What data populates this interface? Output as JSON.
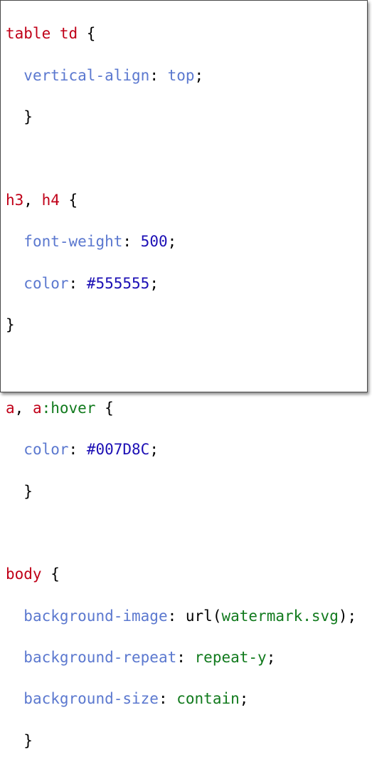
{
  "colors": {
    "selector": "#c00018",
    "property": "#5b78cf",
    "number": "#1c0fb5",
    "string": "#117a1d",
    "punctuation": "#000000"
  },
  "rules": [
    {
      "selector": "table td",
      "declarations": [
        {
          "property": "vertical-align",
          "value": "top"
        }
      ]
    },
    {
      "selector_parts": [
        "h3",
        "h4"
      ],
      "declarations": [
        {
          "property": "font-weight",
          "value": "500"
        },
        {
          "property": "color",
          "value": "#555555"
        }
      ]
    },
    {
      "selector_parts": [
        "a",
        "a",
        ":hover"
      ],
      "declarations": [
        {
          "property": "color",
          "value": "#007D8C"
        }
      ]
    },
    {
      "selector": "body",
      "declarations": [
        {
          "property": "background-image",
          "func": "url",
          "arg": "watermark.svg"
        },
        {
          "property": "background-repeat",
          "value": "repeat-y"
        },
        {
          "property": "background-size",
          "value": "contain"
        }
      ]
    }
  ]
}
